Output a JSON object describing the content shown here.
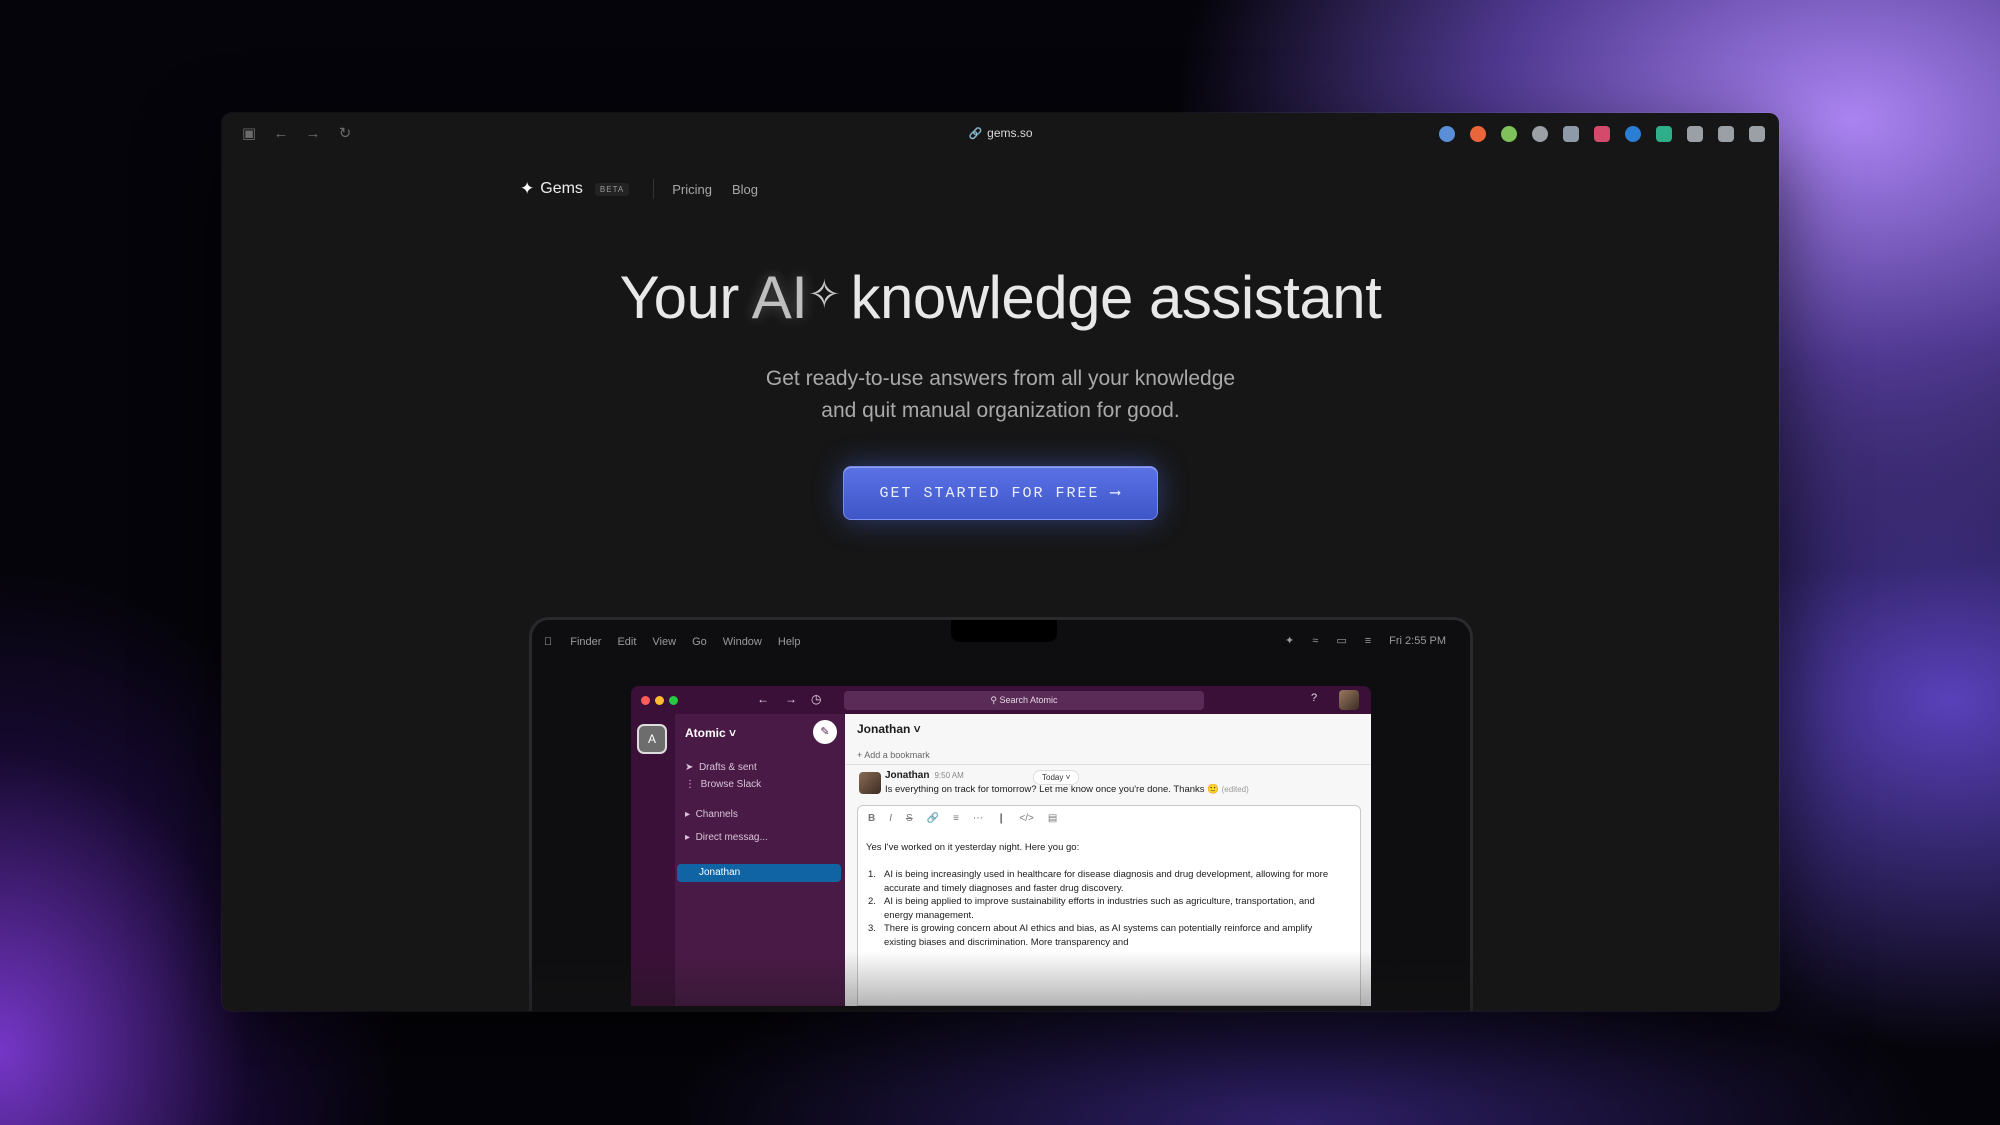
{
  "browser": {
    "url": "gems.so",
    "nav_icons": [
      "sidebar-icon",
      "back-icon",
      "forward-icon",
      "reload-icon"
    ],
    "extension_colors": [
      "#5a8fd8",
      "#e8663a",
      "#7fc15a",
      "#9aa0a6",
      "#8e9aa8",
      "#d44a6a",
      "#2a7fd4",
      "#2fae8a",
      "#9aa0a6",
      "#9aa0a6",
      "#9aa0a6"
    ]
  },
  "nav": {
    "logo": "Gems",
    "badge": "BETA",
    "links": [
      "Pricing",
      "Blog"
    ]
  },
  "hero": {
    "title_pre": "Your",
    "title_ai": "AI",
    "title_post": "knowledge assistant",
    "subtitle_line1": "Get ready-to-use answers from all your knowledge",
    "subtitle_line2": "and quit manual organization for good.",
    "cta": "GET STARTED FOR FREE ⟶"
  },
  "mac": {
    "menu": [
      "Finder",
      "Edit",
      "View",
      "Go",
      "Window",
      "Help"
    ],
    "clock": "Fri 2:55 PM"
  },
  "slack": {
    "search_placeholder": "Search Atomic",
    "workspace_initial": "A",
    "workspace": "Atomic ˅",
    "sidebar": {
      "drafts": "Drafts & sent",
      "browse": "Browse Slack",
      "channels": "Channels",
      "dms": "Direct messag...",
      "active": "Jonathan"
    },
    "chat": {
      "header": "Jonathan ˅",
      "bookmark": "+ Add a bookmark",
      "today": "Today ˅",
      "author": "Jonathan",
      "time": "9:50 AM",
      "message": "Is everything on track for tomorrow? Let me know once you're done. Thanks 🙂",
      "edited": "(edited)",
      "draft_intro": "Yes I've worked on it yesterday night. Here you go:",
      "list": [
        "AI is being increasingly used in healthcare for disease diagnosis and drug development, allowing for more accurate and timely diagnoses and faster drug discovery.",
        "AI is being applied to improve sustainability efforts in industries such as agriculture, transportation, and energy management.",
        "There is growing concern about AI ethics and bias, as AI systems can potentially reinforce and amplify existing biases and discrimination. More transparency and"
      ]
    }
  }
}
